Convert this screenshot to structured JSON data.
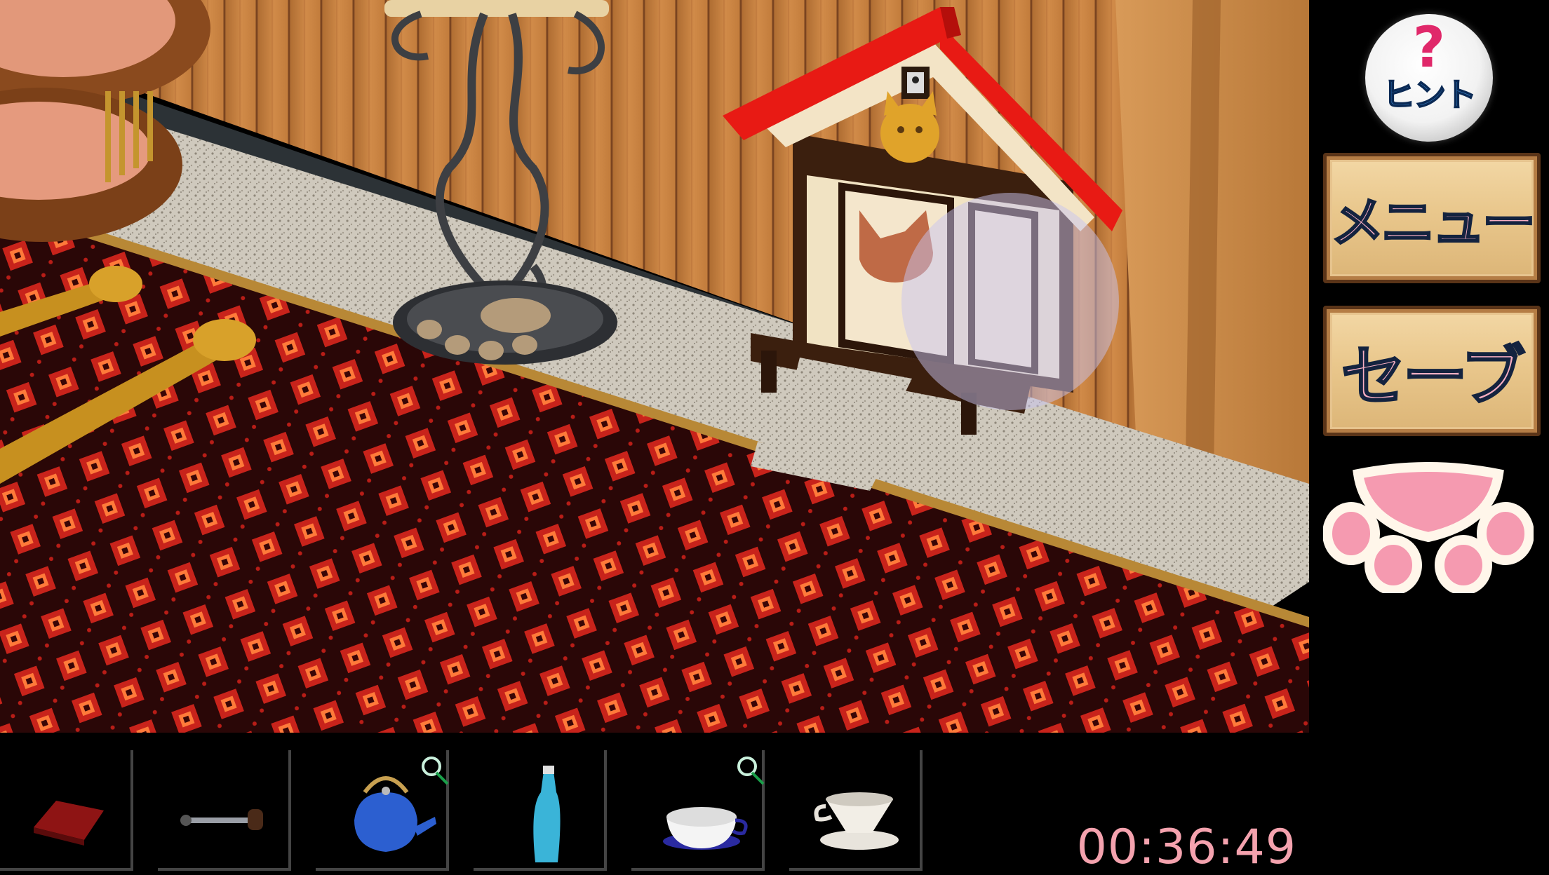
{
  "sidebar": {
    "hint": {
      "symbol": "?",
      "label": "ヒント",
      "icon": "hint-question-icon"
    },
    "menu_label": "メニュー",
    "save_label": "セーブ",
    "paw_icon": "paw-icon"
  },
  "inventory": {
    "items": [
      {
        "name": "red-cloth",
        "selected": false
      },
      {
        "name": "coffee-grinder-handle",
        "selected": false
      },
      {
        "name": "blue-kettle",
        "selected": false,
        "has_magnifier": true
      },
      {
        "name": "blue-bottle",
        "selected": false
      },
      {
        "name": "coffee-cup",
        "selected": false,
        "has_magnifier": true
      },
      {
        "name": "coffee-dripper",
        "selected": false
      }
    ]
  },
  "timer": {
    "value": "00:36:49"
  },
  "colors": {
    "accent_pink": "#f4a2ae",
    "roof_red": "#e81a14",
    "carpet_red": "#c8231b"
  }
}
